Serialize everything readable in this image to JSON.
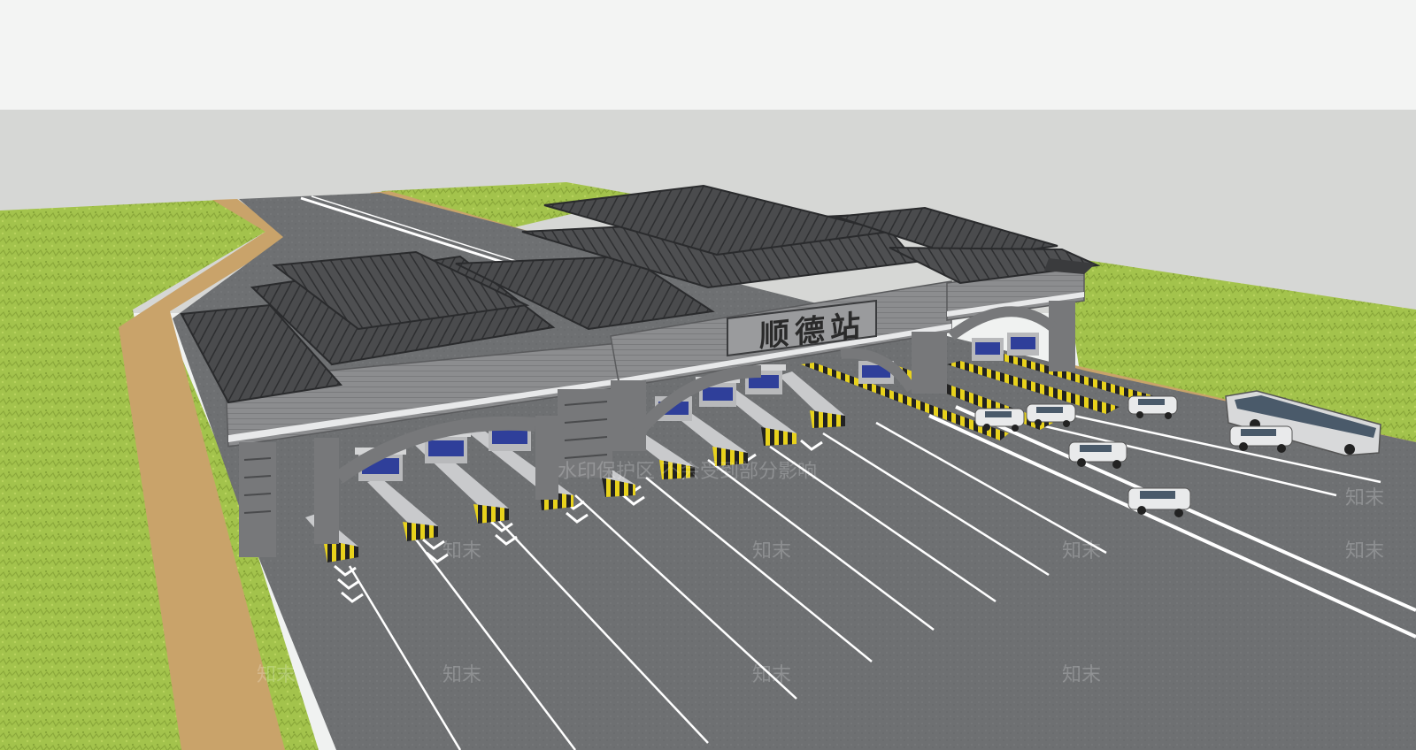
{
  "station_sign": {
    "text": "顺德站"
  },
  "watermark": {
    "brand": "知末",
    "notice": "水印保护区  不会受到部分影响"
  },
  "colors": {
    "sky_top": "#f3f4f3",
    "sky_band": "#d6d7d5",
    "grass": "#9fc04a",
    "dirt_path": "#c9a36a",
    "asphalt": "#6e7072",
    "roof": "#3e3f41",
    "facade": "#8a8b8d",
    "lane_marking": "#ffffff",
    "barrier_yellow": "#e8d21c"
  }
}
